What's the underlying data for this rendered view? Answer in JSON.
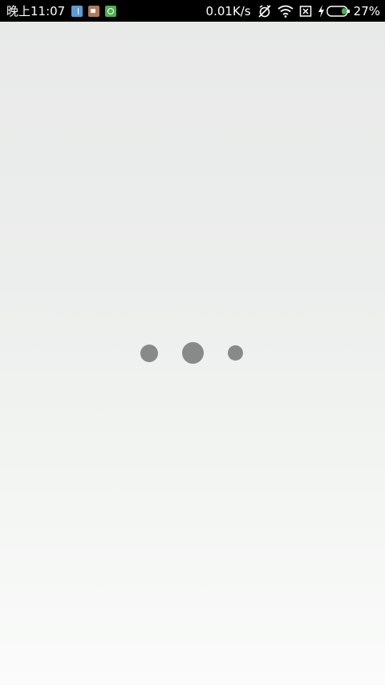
{
  "status_bar": {
    "time": "晚上11:07",
    "network_speed": "0.01K/s",
    "battery_percent": "27%",
    "notification_icons": [
      "bluetooth-icon",
      "camera-icon",
      "sync-icon"
    ],
    "system_icons": [
      "alarm-off-icon",
      "wifi-icon",
      "sim-icon",
      "charging-icon",
      "battery-icon"
    ],
    "battery_level": 0.27,
    "battery_fill_color": "#4caf50"
  },
  "loading_indicator": {
    "dots": 3,
    "dot_color": "#888a89"
  },
  "background_colors": [
    "#e8e9e8",
    "#fafbfa"
  ]
}
